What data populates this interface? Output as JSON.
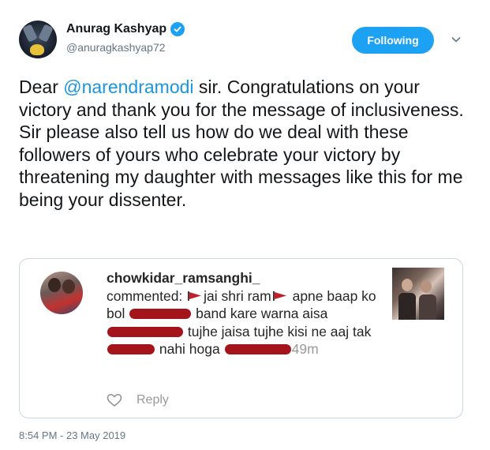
{
  "author": {
    "name": "Anurag Kashyap",
    "handle": "@anuragkashyap72",
    "verified": true
  },
  "actions": {
    "follow_label": "Following",
    "menu_icon": "chevron-down-icon"
  },
  "tweet": {
    "text_before": "Dear ",
    "mention": "@narendramodi",
    "text_after": " sir. Congratulations on your victory and thank you for the message of inclusiveness. Sir please also tell us how do we deal with these followers of yours who celebrate your victory by threatening my daughter with messages like this for me being your dissenter.",
    "timestamp": "8:54 PM - 23 May 2019"
  },
  "embedded_comment": {
    "username": "chowkidar_ramsanghi_",
    "prefix": "commented: ",
    "part1": "jai shri ram",
    "part2": " apne baap ko bol ",
    "part3": " band kare warna aisa ",
    "part4": " tujhe jaisa tujhe kisi ne aaj tak ",
    "part5": " nahi hoga ",
    "age": "49m",
    "reply_label": "Reply",
    "flag_color": "#c0202a",
    "redaction_color": "#a3151a"
  },
  "colors": {
    "accent": "#1da1f2",
    "link": "#1b95e0",
    "text": "#14171a",
    "muted": "#657786"
  }
}
